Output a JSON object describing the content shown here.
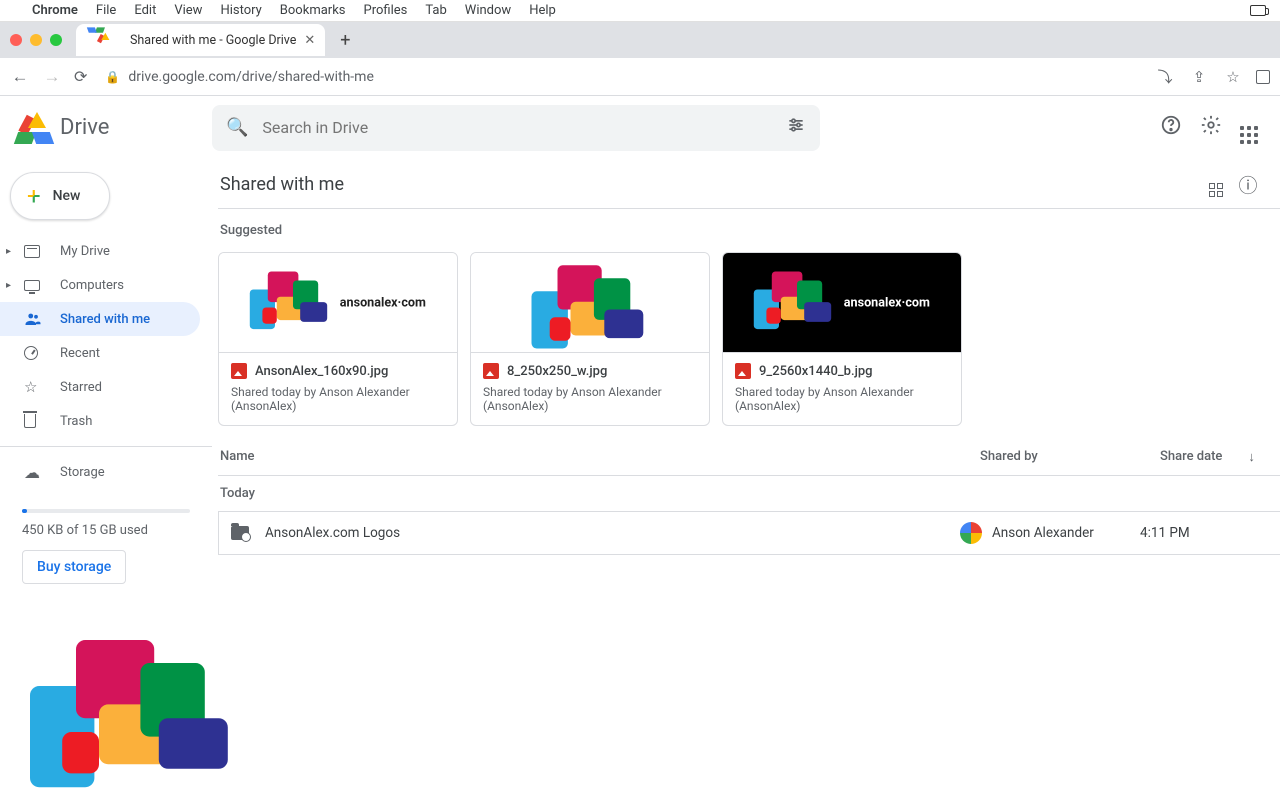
{
  "macos_menu": {
    "app_name": "Chrome",
    "items": [
      "File",
      "Edit",
      "View",
      "History",
      "Bookmarks",
      "Profiles",
      "Tab",
      "Window",
      "Help"
    ]
  },
  "browser": {
    "tab_title": "Shared with me - Google Drive",
    "url": "drive.google.com/drive/shared-with-me"
  },
  "drive_header": {
    "product": "Drive",
    "search_placeholder": "Search in Drive"
  },
  "sidebar": {
    "new_label": "New",
    "items": [
      {
        "label": "My Drive"
      },
      {
        "label": "Computers"
      },
      {
        "label": "Shared with me"
      },
      {
        "label": "Recent"
      },
      {
        "label": "Starred"
      },
      {
        "label": "Trash"
      }
    ],
    "storage": {
      "label": "Storage",
      "usage_text": "450 KB of 15 GB used",
      "buy_label": "Buy storage"
    }
  },
  "main": {
    "title": "Shared with me",
    "suggested_label": "Suggested",
    "cards": [
      {
        "filename": "AnsonAlex_160x90.jpg",
        "meta": "Shared today by Anson Alexander (AnsonAlex)",
        "logo_text": "ansonalex·com",
        "dark": false
      },
      {
        "filename": "8_250x250_w.jpg",
        "meta": "Shared today by Anson Alexander (AnsonAlex)",
        "logo_text": "",
        "dark": false
      },
      {
        "filename": "9_2560x1440_b.jpg",
        "meta": "Shared today by Anson Alexander (AnsonAlex)",
        "logo_text": "ansonalex·com",
        "dark": true
      }
    ],
    "table": {
      "col_name": "Name",
      "col_shared": "Shared by",
      "col_date": "Share date",
      "group_label": "Today",
      "rows": [
        {
          "name": "AnsonAlex.com Logos",
          "shared_by": "Anson Alexander",
          "time": "4:11 PM"
        }
      ]
    }
  }
}
